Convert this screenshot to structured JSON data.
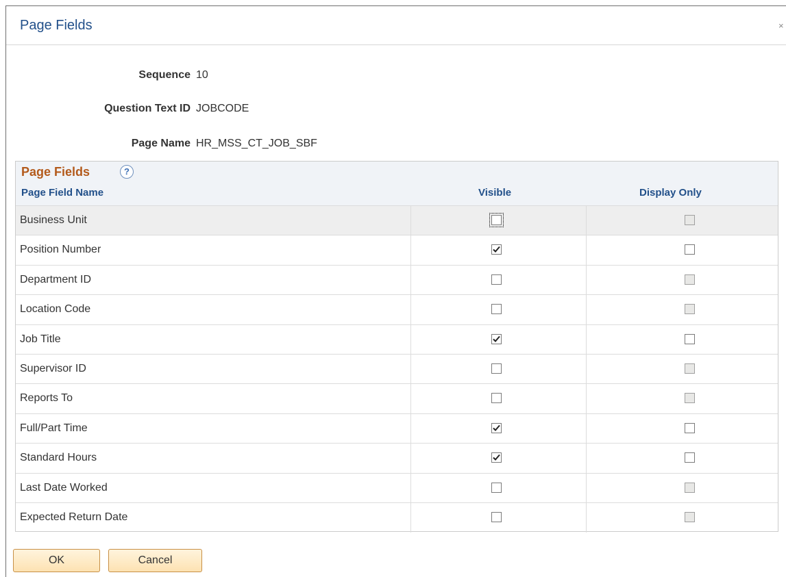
{
  "dialog": {
    "title": "Page Fields",
    "close_glyph": "×"
  },
  "fields": [
    {
      "label": "Sequence",
      "value": "10"
    },
    {
      "label": "Question Text ID",
      "value": "JOBCODE"
    },
    {
      "label": "Page Name",
      "value": "HR_MSS_CT_JOB_SBF"
    }
  ],
  "grid": {
    "title": "Page Fields",
    "help_icon": "?",
    "columns": [
      "Page Field Name",
      "Visible",
      "Display Only"
    ],
    "rows": [
      {
        "name": "Business Unit",
        "visible": false,
        "visible_focus": true,
        "display_only": false,
        "display_only_disabled": true
      },
      {
        "name": "Position Number",
        "visible": true,
        "display_only": false,
        "display_only_disabled": false
      },
      {
        "name": "Department ID",
        "visible": false,
        "display_only": false,
        "display_only_disabled": true
      },
      {
        "name": "Location Code",
        "visible": false,
        "display_only": false,
        "display_only_disabled": true
      },
      {
        "name": "Job Title",
        "visible": true,
        "display_only": false,
        "display_only_disabled": false
      },
      {
        "name": "Supervisor ID",
        "visible": false,
        "display_only": false,
        "display_only_disabled": true
      },
      {
        "name": "Reports To",
        "visible": false,
        "display_only": false,
        "display_only_disabled": true
      },
      {
        "name": "Full/Part Time",
        "visible": true,
        "display_only": false,
        "display_only_disabled": false
      },
      {
        "name": "Standard Hours",
        "visible": true,
        "display_only": false,
        "display_only_disabled": false
      },
      {
        "name": "Last Date Worked",
        "visible": false,
        "display_only": false,
        "display_only_disabled": true
      },
      {
        "name": "Expected Return Date",
        "visible": false,
        "display_only": false,
        "display_only_disabled": true
      }
    ]
  },
  "buttons": {
    "ok": "OK",
    "cancel": "Cancel"
  },
  "colors": {
    "title": "#22508a",
    "grid_title": "#b35a1b",
    "button_border": "#c78f45"
  }
}
